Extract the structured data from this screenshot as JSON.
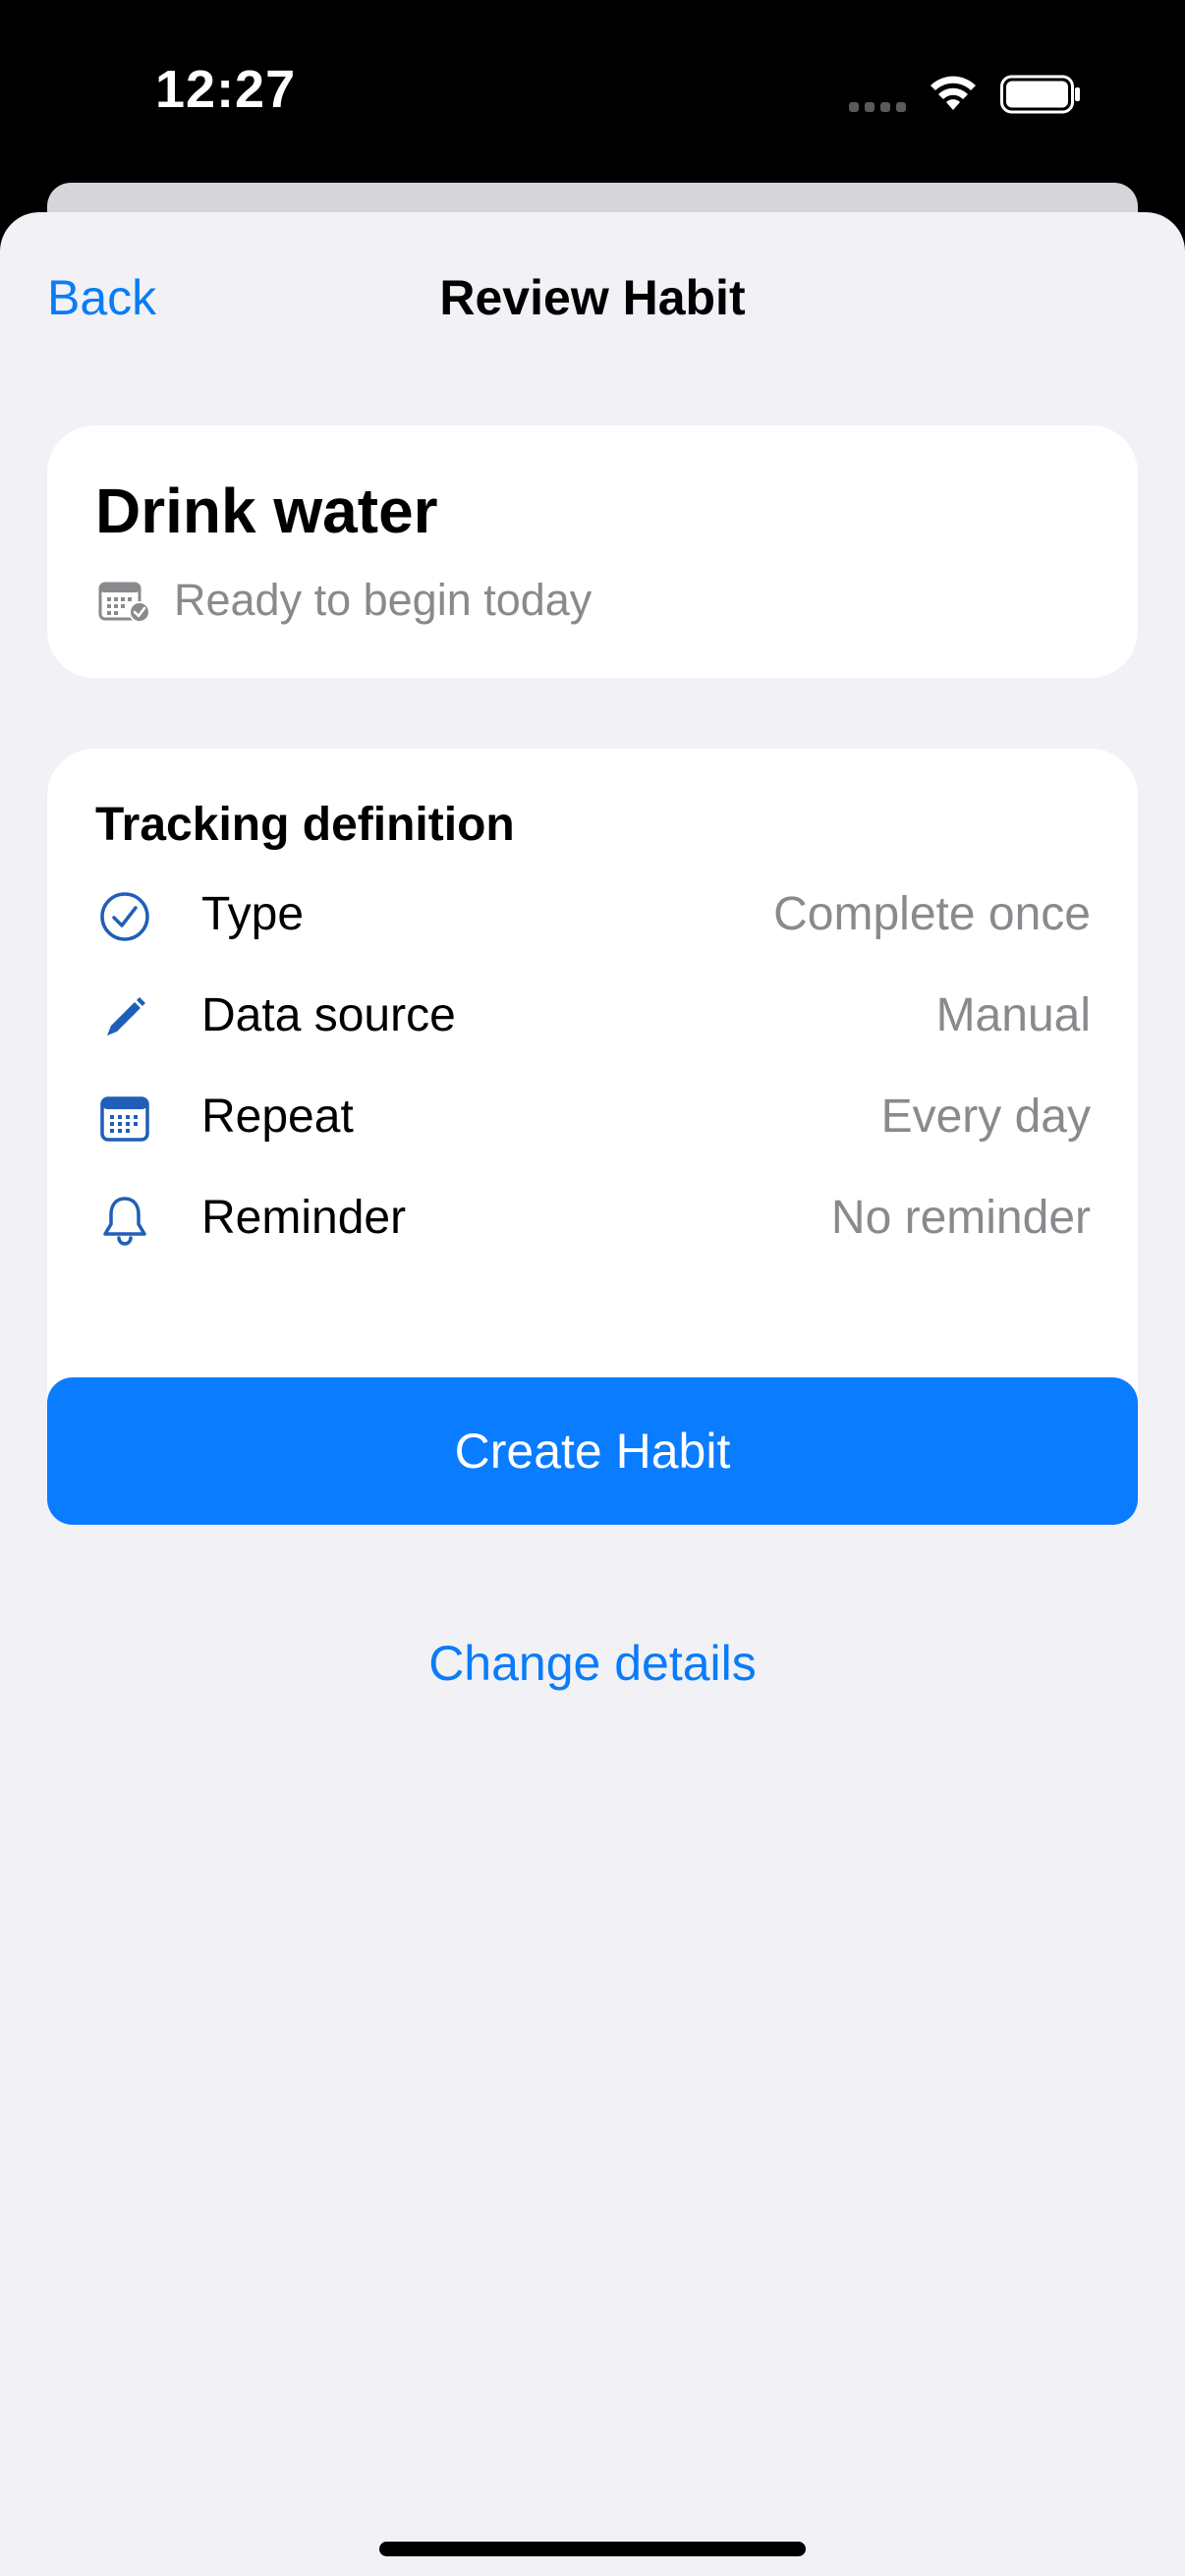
{
  "status_bar": {
    "time": "12:27"
  },
  "nav": {
    "back_label": "Back",
    "title": "Review Habit"
  },
  "habit": {
    "name": "Drink water",
    "status_text": "Ready to begin today",
    "status_icon": "calendar-check-icon"
  },
  "tracking": {
    "section_title": "Tracking definition",
    "rows": [
      {
        "icon": "checkmark-circle-icon",
        "label": "Type",
        "value": "Complete once"
      },
      {
        "icon": "pencil-icon",
        "label": "Data source",
        "value": "Manual"
      },
      {
        "icon": "calendar-icon",
        "label": "Repeat",
        "value": "Every day"
      },
      {
        "icon": "bell-icon",
        "label": "Reminder",
        "value": "No reminder"
      }
    ]
  },
  "actions": {
    "primary_label": "Create Habit",
    "secondary_label": "Change details"
  },
  "colors": {
    "accent": "#0A7CFF",
    "icon_blue": "#1F5FB8",
    "secondary_text": "#8A8A8E",
    "sheet_background": "#F1F1F6"
  }
}
